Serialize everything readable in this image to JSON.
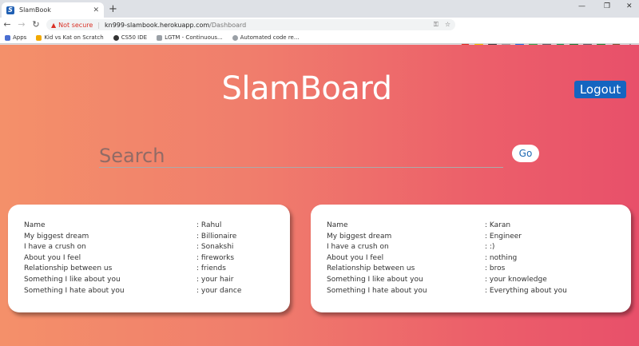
{
  "browser": {
    "tab_title": "SlamBook",
    "tab_favicon": "S",
    "omnibox": {
      "security": "Not secure",
      "url_host": "kn999-slambook.herokuapp.com",
      "url_path": "/Dashboard"
    },
    "bookmarks": [
      {
        "label": "Apps",
        "color": "#4a6fd1"
      },
      {
        "label": "Kid vs Kat on Scratch",
        "color": "#f2a900"
      },
      {
        "label": "CS50 IDE",
        "color": "#333333"
      },
      {
        "label": "LGTM - Continuous...",
        "color": "#9aa0a6"
      },
      {
        "label": "Automated code re...",
        "color": "#9aa0a6"
      }
    ]
  },
  "header": {
    "brand": "SlamBoard",
    "logout_label": "Logout"
  },
  "search": {
    "placeholder": "Search",
    "go_label": "Go"
  },
  "cards": [
    {
      "rows": [
        {
          "label": "Name",
          "value": ": Rahul"
        },
        {
          "label": "My biggest dream",
          "value": ": Billionaire"
        },
        {
          "label": "I have a crush on",
          "value": ": Sonakshi"
        },
        {
          "label": "About you I feel",
          "value": ": fireworks"
        },
        {
          "label": "Relationship between us",
          "value": ": friends"
        },
        {
          "label": "Something I like about you",
          "value": ": your hair"
        },
        {
          "label": "Something I hate about you",
          "value": ": your dance"
        }
      ]
    },
    {
      "rows": [
        {
          "label": "Name",
          "value": ": Karan"
        },
        {
          "label": "My biggest dream",
          "value": ": Engineer"
        },
        {
          "label": "I have a crush on",
          "value": ": :)"
        },
        {
          "label": "About you I feel",
          "value": ": nothing"
        },
        {
          "label": "Relationship between us",
          "value": ": bros"
        },
        {
          "label": "Something I like about you",
          "value": ": your knowledge"
        },
        {
          "label": "Something I hate about you",
          "value": ": Everything about you"
        }
      ]
    }
  ],
  "colors": {
    "gradient_start": "#f4906a",
    "gradient_end": "#e8506a",
    "logout_bg": "#1565c0",
    "go_text": "#1e6ab3"
  }
}
